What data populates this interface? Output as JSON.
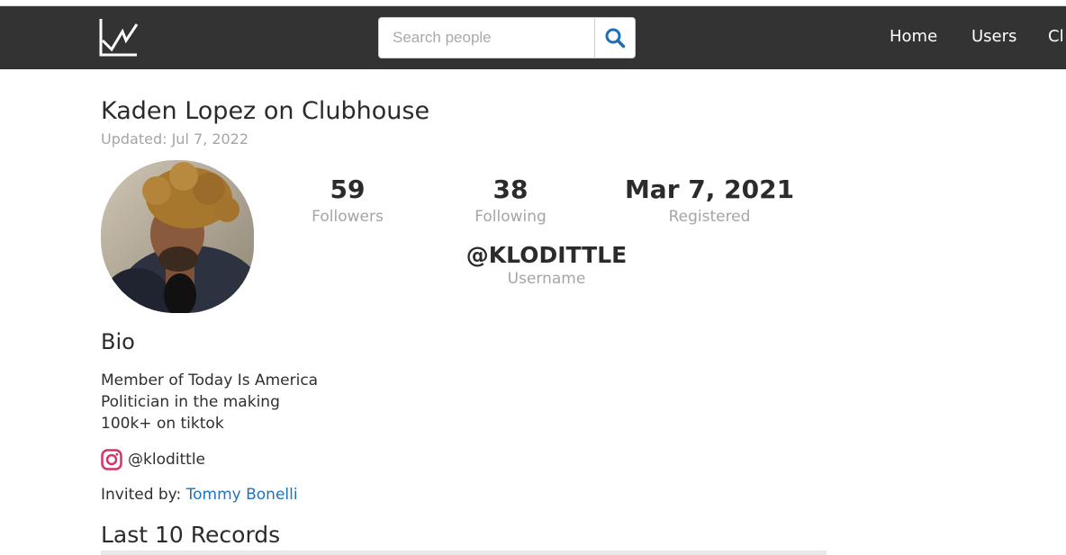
{
  "header": {
    "search_placeholder": "Search people",
    "nav": [
      "Home",
      "Users",
      "Cl"
    ]
  },
  "profile": {
    "title": "Kaden Lopez on Clubhouse",
    "updated": "Updated: Jul 7, 2022",
    "stats": [
      {
        "value": "59",
        "label": "Followers"
      },
      {
        "value": "38",
        "label": "Following"
      },
      {
        "value": "Mar 7, 2021",
        "label": "Registered"
      }
    ],
    "username": {
      "value": "@KLODITTLE",
      "label": "Username"
    }
  },
  "bio": {
    "heading": "Bio",
    "lines": [
      "Member of Today Is America",
      "Politician in the making",
      "100k+ on tiktok"
    ],
    "instagram": "@klodittle",
    "invited_label": "Invited by: ",
    "invited_name": "Tommy Bonelli"
  },
  "records": {
    "heading": "Last 10 Records"
  },
  "colors": {
    "navbar": "#333333",
    "link": "#1e73be",
    "search_icon": "#1a6fb5",
    "instagram": "#d6336c"
  },
  "icons": {
    "logo": "chart-line-icon",
    "search": "search-icon",
    "instagram": "instagram-icon"
  }
}
